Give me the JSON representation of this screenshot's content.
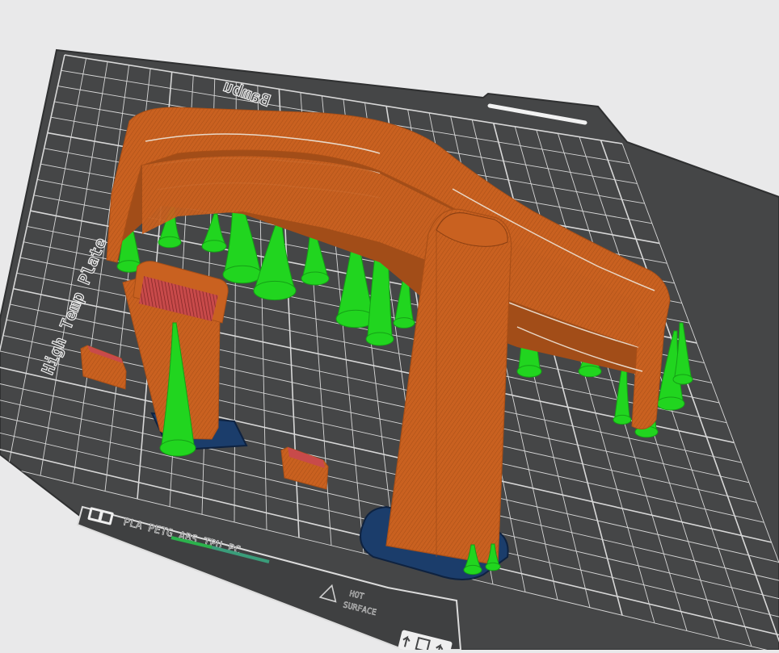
{
  "plate": {
    "brand_text": "Bambu",
    "name_text": "High Temp Plate",
    "filaments_text": "PLA PETG ABS TPU PC",
    "hot_surface_line1": "HOT",
    "hot_surface_line2": "SURFACE"
  },
  "colors": {
    "background": "#e9e9ea",
    "plate_dark": "#454647",
    "grid_line": "#d8d8d8",
    "model_wall": "#c96120",
    "model_shadow": "#9c4a18",
    "model_top": "#c84a4a",
    "support": "#21d51f",
    "support_shadow": "#15a016",
    "brim": "#1b3d6b",
    "accent_green": "#2bb24c"
  },
  "icons": [
    "plate-logo-icon",
    "hot-surface-warning-icon",
    "plate-orientation-icon"
  ]
}
